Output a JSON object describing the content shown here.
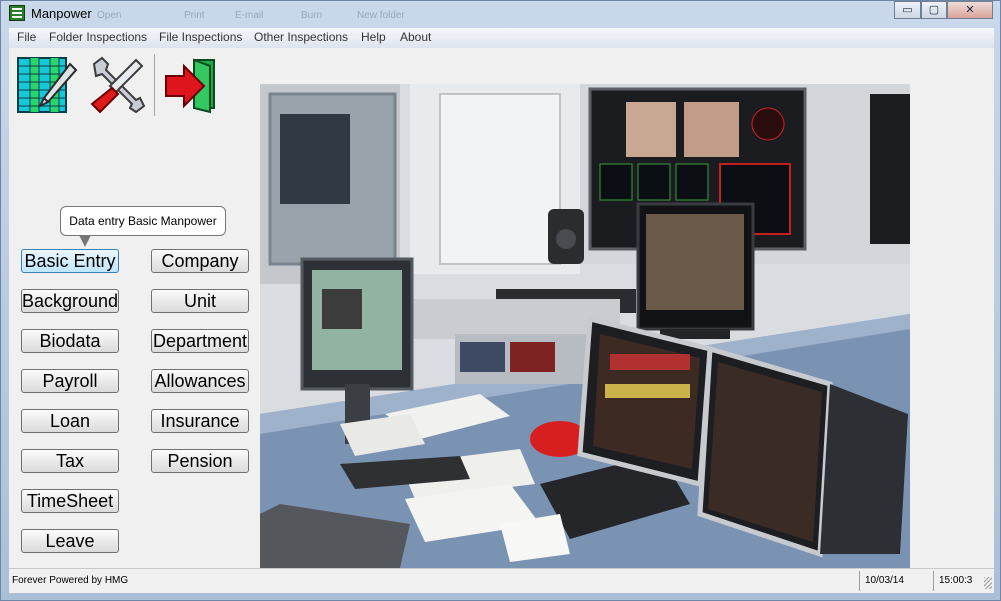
{
  "window": {
    "title": "Manpower",
    "ghost_toolbar": [
      "Open",
      "Print",
      "E-mail",
      "Burn",
      "New folder"
    ],
    "controls": {
      "minimize": "▭",
      "restore": "▢",
      "close": "✕"
    }
  },
  "menu": [
    "File",
    "Folder Inspections",
    "File Inspections",
    "Other Inspections",
    "Help",
    "About"
  ],
  "toolbar": {
    "icons": [
      "data-entry-icon",
      "tools-icon",
      "exit-icon"
    ]
  },
  "tooltip": "Data entry Basic Manpower",
  "buttons_left": [
    "Basic Entry",
    "Background",
    "Biodata",
    "Payroll",
    "Loan",
    "Tax",
    "TimeSheet",
    "Leave"
  ],
  "buttons_right": [
    "Company",
    "Unit",
    "Department",
    "Allowances",
    "Insurance",
    "Pension"
  ],
  "status": {
    "text": "Forever Powered by HMG",
    "date": "10/03/14",
    "time": "15:00:3"
  },
  "colors": {
    "accent": "#3c7fb1",
    "desk": "#7b93b2",
    "wall": "#dfe2e4",
    "exit_arrow": "#e0141c"
  }
}
